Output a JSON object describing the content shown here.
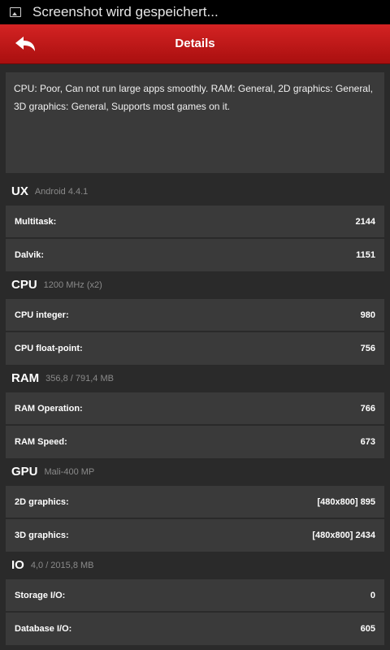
{
  "status_bar": {
    "notification_text": "Screenshot wird gespeichert..."
  },
  "header": {
    "title": "Details"
  },
  "summary": {
    "text": "CPU: Poor, Can not run large apps smoothly. RAM: General, 2D graphics: General, 3D graphics: General, Supports most games on it."
  },
  "sections": [
    {
      "name": "UX",
      "sub": "Android 4.4.1",
      "rows": [
        {
          "label": "Multitask:",
          "value": "2144"
        },
        {
          "label": "Dalvik:",
          "value": "1151"
        }
      ]
    },
    {
      "name": "CPU",
      "sub": "1200 MHz (x2)",
      "rows": [
        {
          "label": "CPU integer:",
          "value": "980"
        },
        {
          "label": "CPU float-point:",
          "value": "756"
        }
      ]
    },
    {
      "name": "RAM",
      "sub": "356,8 / 791,4 MB",
      "rows": [
        {
          "label": "RAM Operation:",
          "value": "766"
        },
        {
          "label": "RAM Speed:",
          "value": "673"
        }
      ]
    },
    {
      "name": "GPU",
      "sub": "Mali-400 MP",
      "rows": [
        {
          "label": "2D graphics:",
          "value": "[480x800] 895"
        },
        {
          "label": "3D graphics:",
          "value": "[480x800] 2434"
        }
      ]
    },
    {
      "name": "IO",
      "sub": "4,0 / 2015,8 MB",
      "rows": [
        {
          "label": "Storage I/O:",
          "value": "0"
        },
        {
          "label": "Database I/O:",
          "value": "605"
        }
      ]
    }
  ]
}
